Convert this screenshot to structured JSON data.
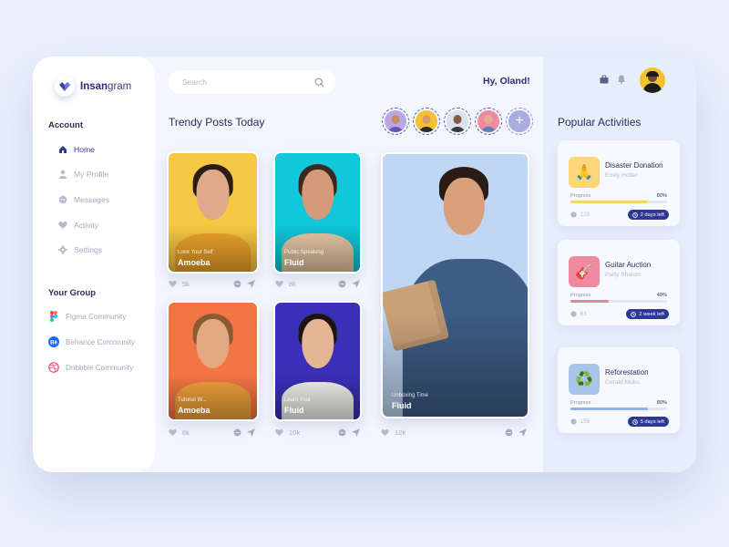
{
  "app": {
    "brand_bold": "Insan",
    "brand_rest": "gram",
    "accent": "#2c3894"
  },
  "sidebar": {
    "account_title": "Account",
    "items": [
      {
        "label": "Home",
        "icon": "home-icon",
        "active": true
      },
      {
        "label": "My Profile",
        "icon": "user-icon",
        "active": false
      },
      {
        "label": "Messages",
        "icon": "chat-icon",
        "active": false
      },
      {
        "label": "Activity",
        "icon": "heart-icon",
        "active": false
      },
      {
        "label": "Settings",
        "icon": "gear-icon",
        "active": false
      }
    ],
    "group_title": "Your Group",
    "groups": [
      {
        "label": "Figma Community",
        "icon": "figma-icon"
      },
      {
        "label": "Behance Community",
        "icon": "behance-icon"
      },
      {
        "label": "Dribbble Community",
        "icon": "dribbble-icon"
      }
    ]
  },
  "header": {
    "search_placeholder": "Search",
    "greeting": "Hy, Oland!"
  },
  "main": {
    "title": "Trendy Posts Today",
    "posts": [
      {
        "caption_small": "Love Your Self",
        "caption_big": "Amoeba",
        "likes": "5k",
        "bg": "#f7c843"
      },
      {
        "caption_small": "Public Speaking",
        "caption_big": "Fluid",
        "likes": "8k",
        "bg": "#12c7dc"
      },
      {
        "caption_small": "Tutorial W...",
        "caption_big": "Amoeba",
        "likes": "6k",
        "bg": "#f37545"
      },
      {
        "caption_small": "Learn Your",
        "caption_big": "Fluid",
        "likes": "10k",
        "bg": "#3a2fb8"
      },
      {
        "caption_small": "Unboxing Time",
        "caption_big": "Fluid",
        "likes": "12k",
        "bg": "#bfd6f4"
      }
    ]
  },
  "right": {
    "title": "Popular Activities",
    "activities": [
      {
        "name": "Disaster Donation",
        "organizer": "Emily Hofter",
        "progress_label": "Progress",
        "progress_pct": "80%",
        "progress": 0.8,
        "comments": "123",
        "due": "2 days left",
        "thumb_icon": "praying-hands-icon",
        "thumb_bg": "#fbd77a",
        "bar_color": "#f7d36a"
      },
      {
        "name": "Guitar Auction",
        "organizer": "Party Shalom",
        "progress_label": "Progress",
        "progress_pct": "40%",
        "progress": 0.4,
        "comments": "63",
        "due": "2 week left",
        "thumb_icon": "guitar-icon",
        "thumb_bg": "#f08aa0",
        "bar_color": "#e8809a"
      },
      {
        "name": "Reforestation",
        "organizer": "Gerald Muko",
        "progress_label": "Progress",
        "progress_pct": "80%",
        "progress": 0.8,
        "comments": "156",
        "due": "5 days left",
        "thumb_icon": "recycle-icon",
        "thumb_bg": "#a9c6ea",
        "bar_color": "#8fb2e4"
      }
    ]
  }
}
